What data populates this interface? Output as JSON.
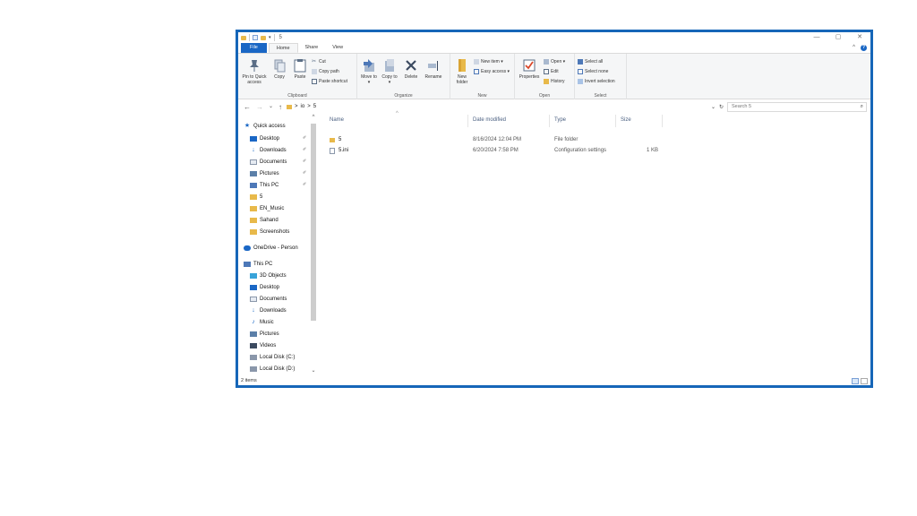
{
  "window": {
    "title": "5",
    "controls": {
      "minimize": "—",
      "maximize": "▢",
      "close": "✕"
    }
  },
  "tabs": [
    {
      "label": "File"
    },
    {
      "label": "Home"
    },
    {
      "label": "Share"
    },
    {
      "label": "View"
    }
  ],
  "ribbon": {
    "clipboard": {
      "label": "Clipboard",
      "pin": "Pin to Quick access",
      "copy": "Copy",
      "paste": "Paste",
      "cut": "Cut",
      "copy_path": "Copy path",
      "paste_shortcut": "Paste shortcut"
    },
    "organize": {
      "label": "Organize",
      "move_to": "Move to ▾",
      "copy_to": "Copy to ▾",
      "delete": "Delete",
      "rename": "Rename"
    },
    "new": {
      "label": "New",
      "new_folder": "New folder",
      "new_item": "New item ▾",
      "easy_access": "Easy access ▾"
    },
    "open": {
      "label": "Open",
      "properties": "Properties",
      "open": "Open ▾",
      "edit": "Edit",
      "history": "History"
    },
    "select": {
      "label": "Select",
      "select_all": "Select all",
      "select_none": "Select none",
      "invert_selection": "Invert selection"
    }
  },
  "address": {
    "back": "←",
    "forward": "→",
    "recent": "⌄",
    "up": "↑",
    "crumbs": [
      "io",
      "5"
    ],
    "sep": ">",
    "dropdown": "⌄",
    "refresh": "↻",
    "search_placeholder": "Search 5",
    "search_icon": "⌕"
  },
  "nav_pane": {
    "items": [
      {
        "label": "Quick access",
        "icon": "star-icon"
      },
      {
        "label": "Desktop",
        "icon": "desktop-icon",
        "pinned": true
      },
      {
        "label": "Downloads",
        "icon": "download-icon",
        "pinned": true
      },
      {
        "label": "Documents",
        "icon": "documents-icon",
        "pinned": true
      },
      {
        "label": "Pictures",
        "icon": "pictures-icon",
        "pinned": true
      },
      {
        "label": "This PC",
        "icon": "computer-icon",
        "pinned": true
      },
      {
        "label": "5",
        "icon": "folder-icon"
      },
      {
        "label": "EN_Music",
        "icon": "folder-icon"
      },
      {
        "label": "Sahand",
        "icon": "folder-icon"
      },
      {
        "label": "Screenshots",
        "icon": "folder-icon"
      },
      {
        "label": "OneDrive - Person",
        "icon": "cloud-icon"
      },
      {
        "label": "This PC",
        "icon": "computer-icon"
      },
      {
        "label": "3D Objects",
        "icon": "3d-objects-icon"
      },
      {
        "label": "Desktop",
        "icon": "desktop-icon"
      },
      {
        "label": "Documents",
        "icon": "documents-icon"
      },
      {
        "label": "Downloads",
        "icon": "download-icon"
      },
      {
        "label": "Music",
        "icon": "music-icon"
      },
      {
        "label": "Pictures",
        "icon": "pictures-icon"
      },
      {
        "label": "Videos",
        "icon": "videos-icon"
      },
      {
        "label": "Local Disk (C:)",
        "icon": "drive-icon"
      },
      {
        "label": "Local Disk (D:)",
        "icon": "drive-icon"
      }
    ],
    "pin_glyph": "✐"
  },
  "columns": {
    "name": "Name",
    "date": "Date modified",
    "type": "Type",
    "size": "Size"
  },
  "files": [
    {
      "name": "5",
      "date": "8/16/2024 12:04 PM",
      "type": "File folder",
      "size": ""
    },
    {
      "name": "5.ini",
      "date": "6/20/2024 7:58 PM",
      "type": "Configuration settings",
      "size": "1 KB"
    }
  ],
  "status": {
    "count": "2 items"
  },
  "colors": {
    "accent": "#1a67c5",
    "frame": "#1666b8",
    "folder": "#e8b94a"
  }
}
